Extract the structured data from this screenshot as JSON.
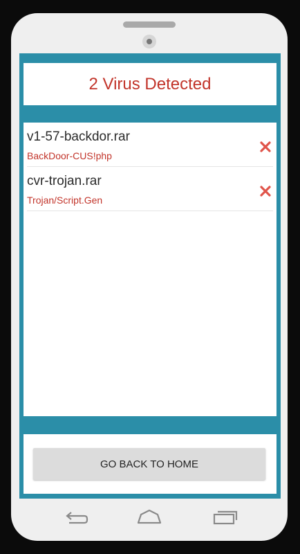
{
  "header": {
    "title": "2 Virus Detected"
  },
  "threats": [
    {
      "file_name": "v1-57-backdor.rar",
      "threat": "BackDoor-CUS!php",
      "remove_icon": "close-icon"
    },
    {
      "file_name": "cvr-trojan.rar",
      "threat": "Trojan/Script.Gen",
      "remove_icon": "close-icon"
    }
  ],
  "actions": {
    "home_button_label": "GO BACK TO HOME"
  },
  "nav": {
    "icons": [
      "back-icon",
      "home-icon",
      "recents-icon"
    ]
  },
  "colors": {
    "accent": "#2b8ea8",
    "danger": "#c2342a",
    "remove_icon": "#e0544a"
  }
}
